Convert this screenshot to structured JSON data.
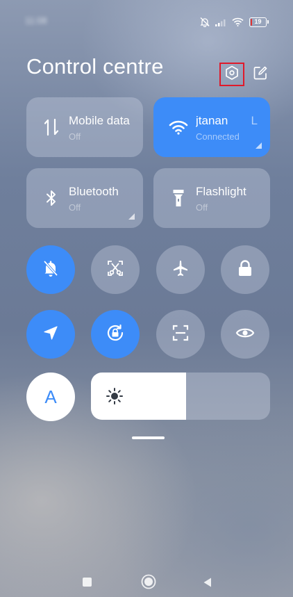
{
  "status_bar": {
    "time": "11:08",
    "battery_level": "19",
    "battery_fraction": 0.19,
    "icons": [
      "bell-off-icon",
      "cellular-signal-icon",
      "wifi-icon",
      "battery-icon"
    ]
  },
  "header": {
    "title": "Control centre",
    "settings_icon": "settings-hexagon-icon",
    "edit_icon": "edit-pencil-icon"
  },
  "tiles": [
    {
      "label": "Mobile data",
      "status": "Off",
      "active": false,
      "icon": "mobile-data-arrows-icon"
    },
    {
      "label": "jtanan",
      "status": "Connected",
      "extra": "L",
      "active": true,
      "icon": "wifi-icon"
    },
    {
      "label": "Bluetooth",
      "status": "Off",
      "active": false,
      "icon": "bluetooth-icon"
    },
    {
      "label": "Flashlight",
      "status": "Off",
      "active": false,
      "icon": "flashlight-icon"
    }
  ],
  "toggles": [
    {
      "name": "silent",
      "icon": "bell-off-icon",
      "active": true
    },
    {
      "name": "screenshot",
      "icon": "scissors-screenshot-icon",
      "active": false
    },
    {
      "name": "airplane-mode",
      "icon": "airplane-icon",
      "active": false
    },
    {
      "name": "lock-screen",
      "icon": "lock-icon",
      "active": false
    },
    {
      "name": "location",
      "icon": "location-arrow-icon",
      "active": true
    },
    {
      "name": "rotation-lock",
      "icon": "rotation-lock-icon",
      "active": true
    },
    {
      "name": "scanner",
      "icon": "scan-frame-icon",
      "active": false
    },
    {
      "name": "reading-mode",
      "icon": "eye-icon",
      "active": false
    }
  ],
  "auto_brightness": {
    "label": "A"
  },
  "brightness": {
    "level": 0.53,
    "icon": "sun-icon"
  },
  "nav_bar": {
    "icons": [
      "recents-square-icon",
      "home-circle-icon",
      "back-triangle-icon"
    ]
  },
  "colors": {
    "accent": "#3d8cf8",
    "highlight_box": "#e0192a",
    "battery_low": "#e03131"
  }
}
